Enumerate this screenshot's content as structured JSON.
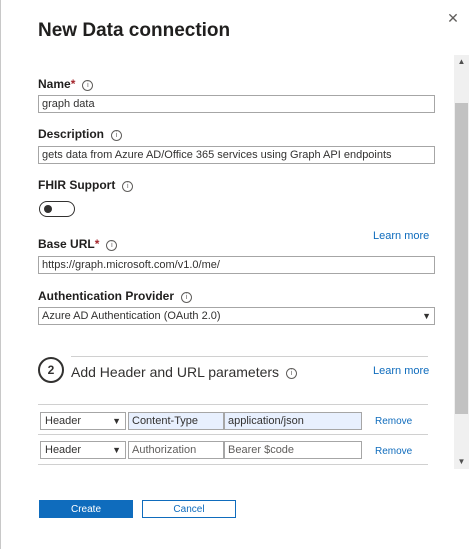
{
  "dialog": {
    "title": "New Data connection",
    "close_icon": "close-icon"
  },
  "fields": {
    "name": {
      "label": "Name",
      "required_mark": "*",
      "value": "graph data"
    },
    "description": {
      "label": "Description",
      "value": "gets data from Azure AD/Office 365 services using Graph API endpoints"
    },
    "fhir": {
      "label": "FHIR Support",
      "enabled": false
    },
    "base_url": {
      "label": "Base URL",
      "required_mark": "*",
      "value": "https://graph.microsoft.com/v1.0/me/",
      "learn_more": "Learn more"
    },
    "auth": {
      "label": "Authentication Provider",
      "value": "Azure AD Authentication (OAuth 2.0)"
    }
  },
  "section": {
    "step": "2",
    "title": "Add Header and URL parameters",
    "learn_more": "Learn more"
  },
  "params": [
    {
      "type": "Header",
      "key": "Content-Type",
      "value": "application/json",
      "remove": "Remove",
      "filled": true
    },
    {
      "type": "Header",
      "key": "Authorization",
      "value": "Bearer $code",
      "remove": "Remove",
      "filled": false
    }
  ],
  "buttons": {
    "create": "Create",
    "cancel": "Cancel"
  },
  "colors": {
    "accent": "#0f6cbd",
    "required": "#a4262c"
  }
}
